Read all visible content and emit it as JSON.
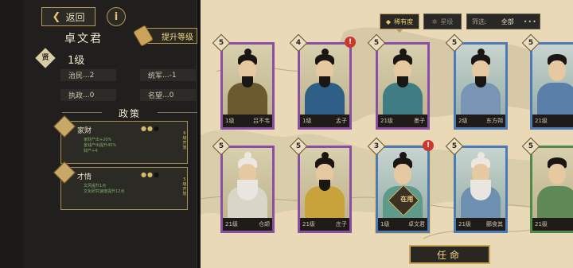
{
  "detail": {
    "back_label": "返回",
    "info_glyph": "i",
    "name": "卓文君",
    "upgrade_label": "提升等级",
    "rank_badge": "贤",
    "level": "1级",
    "stats": [
      {
        "label": "治民",
        "value": "...2"
      },
      {
        "label": "统军",
        "value": "...-1"
      },
      {
        "label": "执政",
        "value": "...0"
      },
      {
        "label": "名望",
        "value": "...0"
      }
    ],
    "policy_title": "政策",
    "policies": [
      {
        "name": "家财",
        "desc": "家财产出+20%\n金钱产出提升45%\n财产+4",
        "side": "6级开放",
        "icon": "money-bag-icon",
        "filled_dots": 2,
        "total_dots": 3
      },
      {
        "name": "才情",
        "desc": "文风提升1点\n文化研究速度提升12点",
        "side": "5级开放",
        "icon": "scroll-quill-icon",
        "filled_dots": 2,
        "total_dots": 3
      }
    ]
  },
  "toolbar": {
    "sort_rarity_label": "稀有度",
    "sort_star_label": "星级",
    "filter_label": "筛选:",
    "filter_value": "全部",
    "more_glyph": "•••"
  },
  "heroes": [
    {
      "name": "吕不韦",
      "level": "1级",
      "stars": "5",
      "frame": "purple",
      "alert": false,
      "in_use": false
    },
    {
      "name": "孟子",
      "level": "1级",
      "stars": "4",
      "frame": "purple",
      "alert": true,
      "in_use": false
    },
    {
      "name": "墨子",
      "level": "21级",
      "stars": "5",
      "frame": "purple",
      "alert": false,
      "in_use": false
    },
    {
      "name": "东方朔",
      "level": "2级",
      "stars": "5",
      "frame": "blue",
      "alert": false,
      "in_use": false
    },
    {
      "name": "",
      "level": "21级",
      "stars": "5",
      "frame": "blue",
      "alert": false,
      "in_use": false
    },
    {
      "name": "仓颉",
      "level": "21级",
      "stars": "5",
      "frame": "purple",
      "alert": false,
      "in_use": false
    },
    {
      "name": "庄子",
      "level": "21级",
      "stars": "5",
      "frame": "purple",
      "alert": false,
      "in_use": false
    },
    {
      "name": "卓文君",
      "level": "1级",
      "stars": "3",
      "frame": "blue",
      "alert": true,
      "in_use": true,
      "in_use_label": "在用"
    },
    {
      "name": "郦食其",
      "level": "21级",
      "stars": "5",
      "frame": "blue",
      "alert": false,
      "in_use": false
    },
    {
      "name": "",
      "level": "21级",
      "stars": "5",
      "frame": "green",
      "alert": false,
      "in_use": false
    }
  ],
  "appoint_label": "任命",
  "colors": {
    "purple_frame": "#8a4fa5",
    "blue_frame": "#4c7ab8",
    "green_frame": "#4f8a4a",
    "gold": "#c9a653",
    "panel": "#201f1d"
  }
}
